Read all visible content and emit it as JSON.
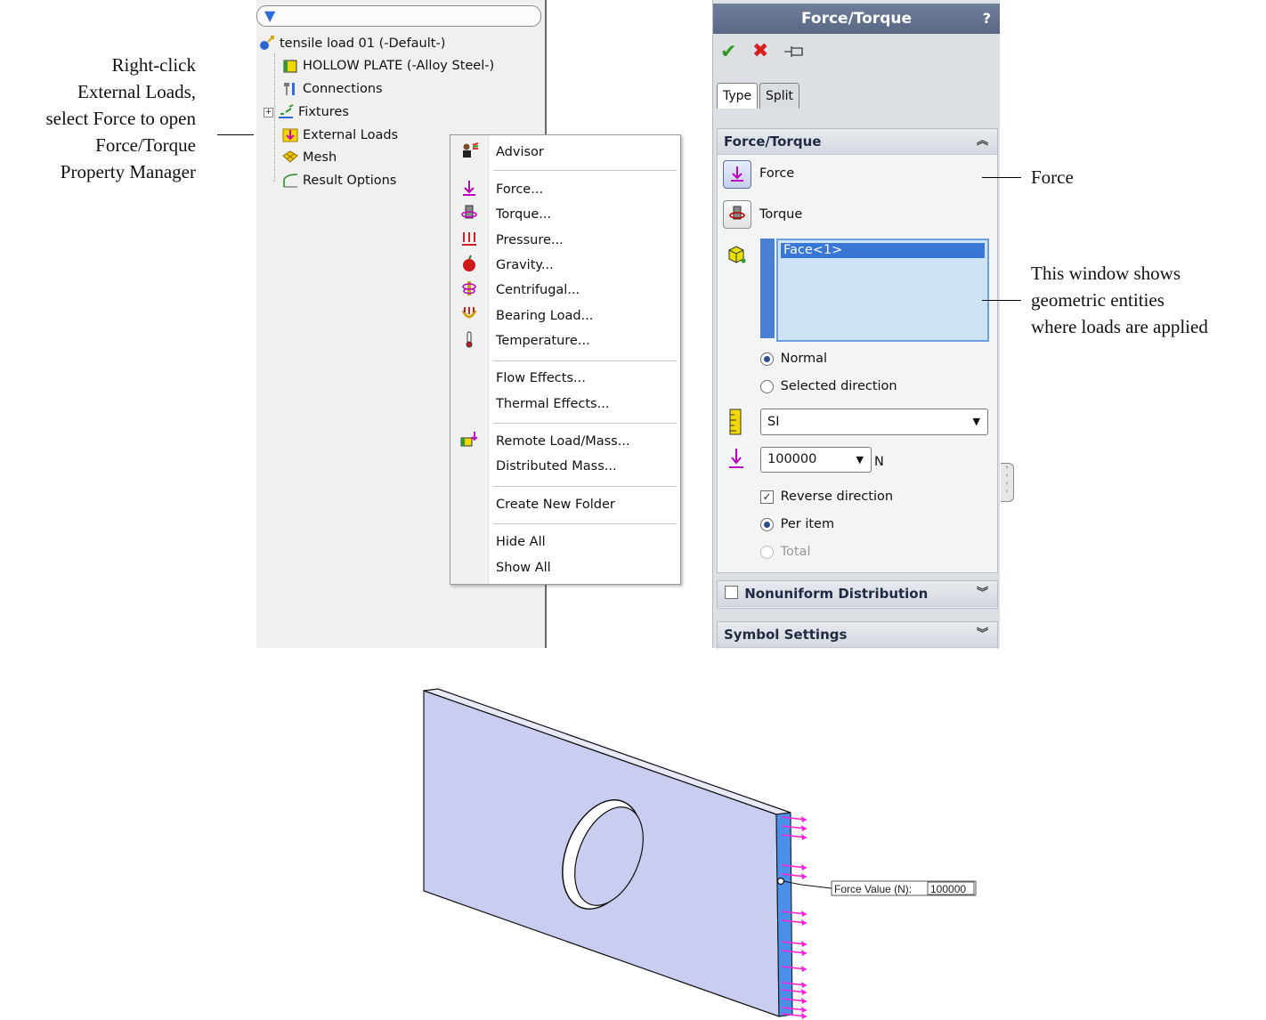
{
  "annotations": {
    "left_lines": [
      "Right-click",
      "External Loads,",
      "select Force to open",
      "Force/Torque",
      "Property Manager"
    ],
    "force": "Force",
    "window_lines": [
      "This window shows",
      "geometric entities",
      "where loads are applied"
    ]
  },
  "tree": {
    "root": "tensile load 01 (-Default-)",
    "items": [
      {
        "label": "HOLLOW PLATE (-Alloy Steel-)",
        "icon": "part-icon"
      },
      {
        "label": "Connections",
        "icon": "connections-icon"
      },
      {
        "label": "Fixtures",
        "icon": "fixtures-icon"
      },
      {
        "label": "External Loads",
        "icon": "external-loads-icon"
      },
      {
        "label": "Mesh",
        "icon": "mesh-icon"
      },
      {
        "label": "Result Options",
        "icon": "result-options-icon"
      }
    ]
  },
  "menu": {
    "advisor": "Advisor",
    "force": "Force...",
    "torque": "Torque...",
    "pressure": "Pressure...",
    "gravity": "Gravity...",
    "centrifugal": "Centrifugal...",
    "bearing": "Bearing Load...",
    "temperature": "Temperature...",
    "flow": "Flow Effects...",
    "thermal": "Thermal Effects...",
    "remote": "Remote Load/Mass...",
    "distributed": "Distributed Mass...",
    "folder": "Create New Folder",
    "hide": "Hide All",
    "show": "Show All"
  },
  "pm": {
    "title": "Force/Torque",
    "help": "?",
    "tabs": [
      "Type",
      "Split"
    ],
    "group_title": "Force/Torque",
    "force_label": "Force",
    "torque_label": "Torque",
    "selection": "Face<1>",
    "normal": "Normal",
    "selected_direction": "Selected direction",
    "units": "SI",
    "value": "100000",
    "unit": "N",
    "reverse": "Reverse direction",
    "per_item": "Per item",
    "total": "Total",
    "nonuniform": "Nonuniform Distribution",
    "symbol": "Symbol Settings"
  },
  "model": {
    "callout_label": "Force Value (N):",
    "callout_value": "100000",
    "arrow_color": "#ff22dd",
    "plate_color": "#c9cdef",
    "edge_color": "#4a90e8"
  }
}
